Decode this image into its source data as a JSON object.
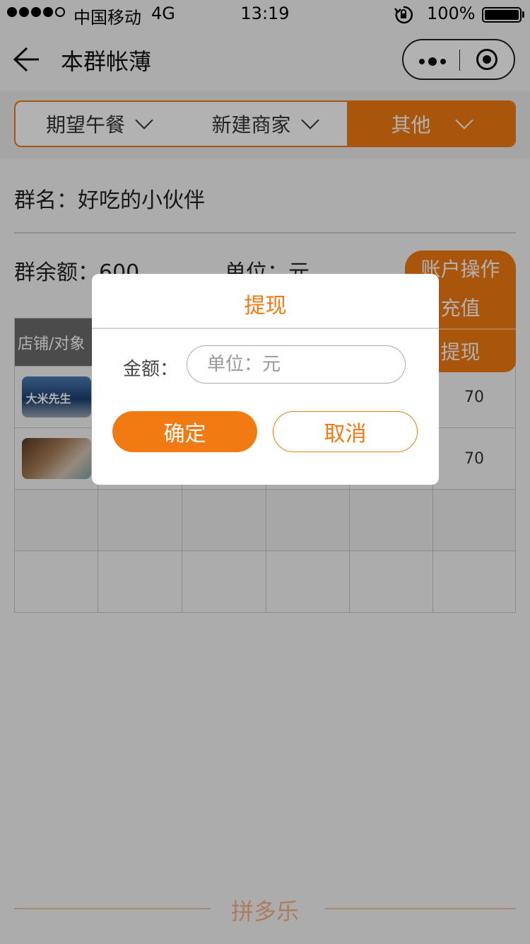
{
  "status_bar": {
    "carrier": "中国移动",
    "network": "4G",
    "time": "13:19",
    "battery": "100%"
  },
  "nav": {
    "title": "本群帐薄"
  },
  "tabs": [
    {
      "label": "期望午餐",
      "active": false
    },
    {
      "label": "新建商家",
      "active": false
    },
    {
      "label": "其他",
      "active": true
    }
  ],
  "group": {
    "name_text": "群名：好吃的小伙伴",
    "balance_text": "群余额：600",
    "unit_text": "单位：元"
  },
  "account": {
    "button": "账户操作",
    "items": [
      "充值",
      "提现"
    ]
  },
  "table": {
    "header": [
      "店铺/对象",
      "",
      "",
      "",
      "",
      ""
    ],
    "rows": [
      {
        "thumb": "大米先生",
        "cells": [
          "",
          "",
          "",
          "",
          "70"
        ]
      },
      {
        "thumb": "",
        "cells": [
          "",
          "",
          "",
          "",
          "70"
        ]
      },
      {
        "thumb": "",
        "cells": [
          "",
          "",
          "",
          "",
          ""
        ]
      },
      {
        "thumb": "",
        "cells": [
          "",
          "",
          "",
          "",
          ""
        ]
      }
    ]
  },
  "dialog": {
    "title": "提现",
    "amount_label": "金额：",
    "amount_placeholder": "单位：元",
    "confirm": "确定",
    "cancel": "取消"
  },
  "footer": {
    "brand": "拼多乐"
  },
  "colors": {
    "accent": "#f27a12",
    "overlay": "rgba(0,0,0,0.3)"
  }
}
